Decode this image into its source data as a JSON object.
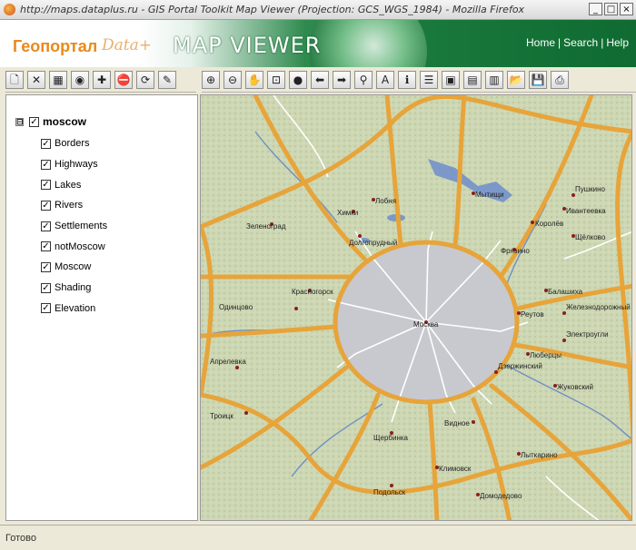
{
  "window": {
    "title": "http://maps.dataplus.ru - GIS Portal Toolkit Map Viewer (Projection: GCS_WGS_1984) - Mozilla Firefox",
    "controls": [
      "_",
      "□",
      "×"
    ]
  },
  "banner": {
    "brand_ru": "Геопортал",
    "brand_logo": "Data+",
    "app_title": "MAP VIEWER",
    "links": [
      "Home",
      "Search",
      "Help"
    ],
    "link_separator": "|"
  },
  "left_toolbar": [
    {
      "name": "new-doc-icon",
      "glyph": "🗋"
    },
    {
      "name": "delete-icon",
      "glyph": "✕"
    },
    {
      "name": "layers-icon",
      "glyph": "▦"
    },
    {
      "name": "globe-icon",
      "glyph": "◉"
    },
    {
      "name": "add-layer-icon",
      "glyph": "✚"
    },
    {
      "name": "stop-icon",
      "glyph": "⛔"
    },
    {
      "name": "refresh-icon",
      "glyph": "⟳"
    },
    {
      "name": "pen-icon",
      "glyph": "✎"
    }
  ],
  "map_toolbar": [
    {
      "name": "zoom-in-icon",
      "glyph": "⊕"
    },
    {
      "name": "zoom-out-icon",
      "glyph": "⊖"
    },
    {
      "name": "pan-hand-icon",
      "glyph": "✋"
    },
    {
      "name": "zoom-extent-icon",
      "glyph": "⊡"
    },
    {
      "name": "full-extent-globe-icon",
      "glyph": "●"
    },
    {
      "name": "back-arrow-icon",
      "glyph": "⬅"
    },
    {
      "name": "forward-arrow-icon",
      "glyph": "➡"
    },
    {
      "name": "find-binoculars-icon",
      "glyph": "⚲"
    },
    {
      "name": "text-tool-icon",
      "glyph": "A"
    },
    {
      "name": "identify-icon",
      "glyph": "ℹ"
    },
    {
      "name": "legend-icon",
      "glyph": "☰"
    },
    {
      "name": "select-icon",
      "glyph": "▣"
    },
    {
      "name": "clear-selection-icon",
      "glyph": "▤"
    },
    {
      "name": "measure-icon",
      "glyph": "▥"
    },
    {
      "name": "open-folder-icon",
      "glyph": "📂"
    },
    {
      "name": "save-icon",
      "glyph": "💾"
    },
    {
      "name": "print-icon",
      "glyph": "⎙"
    }
  ],
  "layer_tree": {
    "root": {
      "label": "moscow",
      "checked": true,
      "expander": "⊟"
    },
    "layers": [
      {
        "label": "Borders",
        "checked": true
      },
      {
        "label": "Highways",
        "checked": true
      },
      {
        "label": "Lakes",
        "checked": true
      },
      {
        "label": "Rivers",
        "checked": true
      },
      {
        "label": "Settlements",
        "checked": true
      },
      {
        "label": "notMoscow",
        "checked": true
      },
      {
        "label": "Moscow",
        "checked": true
      },
      {
        "label": "Shading",
        "checked": true
      },
      {
        "label": "Elevation",
        "checked": true
      }
    ],
    "check_glyph": "✓"
  },
  "map": {
    "colors": {
      "terrain": "#cdd7b3",
      "city": "#c8c8cf",
      "road": "#e7a43a",
      "water": "#6f8fc4",
      "minor_road": "#ffffff"
    },
    "labels": [
      "Зеленоград",
      "Мытищи",
      "Лобня",
      "Долгопрудный",
      "Королёв",
      "Щёлково",
      "Фрязино",
      "Балашиха",
      "Реутов",
      "Красногорск",
      "Одинцово",
      "Москва",
      "Люберцы",
      "Жуковский",
      "Видное",
      "Подольск",
      "Щербинка",
      "Домодедово",
      "Троицк",
      "Химки",
      "Пушкино",
      "Ивантеевка",
      "Железнодорожный",
      "Электроугли",
      "Апрелевка",
      "Лыткарино",
      "Дзержинский",
      "Климовск"
    ]
  },
  "status": {
    "text": "Готово"
  }
}
